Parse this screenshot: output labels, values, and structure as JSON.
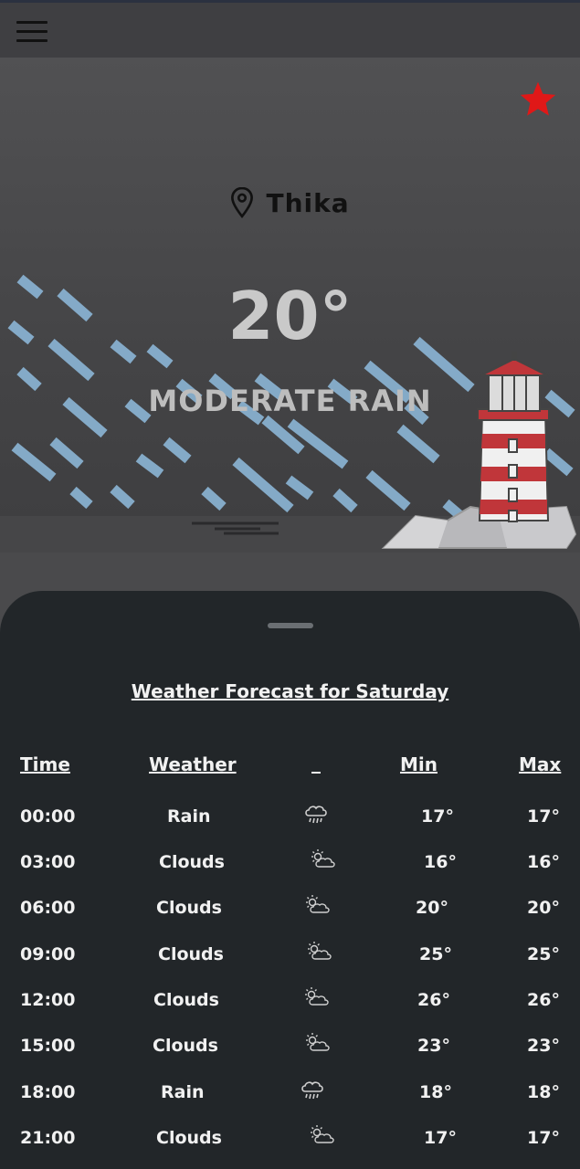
{
  "header": {
    "menu_icon": "hamburger-menu-icon"
  },
  "hero": {
    "favorite_icon": "star-icon",
    "favorite_color": "#e01818",
    "location_icon": "map-pin-icon",
    "city": "Thika",
    "temperature": "20°",
    "description": "MODERATE RAIN",
    "rain_color": "#88b0cf"
  },
  "forecast": {
    "title": "Weather Forecast for Saturday",
    "columns": [
      "Time",
      "Weather",
      "_",
      "Min",
      "Max"
    ],
    "rows": [
      {
        "time": "00:00",
        "weather": "Rain",
        "icon": "rain-cloud-icon",
        "min": "17°",
        "max": "17°"
      },
      {
        "time": "03:00",
        "weather": "Clouds",
        "icon": "sun-cloud-icon",
        "min": "16°",
        "max": "16°"
      },
      {
        "time": "06:00",
        "weather": "Clouds",
        "icon": "sun-cloud-icon",
        "min": "20°",
        "max": "20°"
      },
      {
        "time": "09:00",
        "weather": "Clouds",
        "icon": "sun-cloud-icon",
        "min": "25°",
        "max": "25°"
      },
      {
        "time": "12:00",
        "weather": "Clouds",
        "icon": "sun-cloud-icon",
        "min": "26°",
        "max": "26°"
      },
      {
        "time": "15:00",
        "weather": "Clouds",
        "icon": "sun-cloud-icon",
        "min": "23°",
        "max": "23°"
      },
      {
        "time": "18:00",
        "weather": "Rain",
        "icon": "rain-cloud-icon",
        "min": "18°",
        "max": "18°"
      },
      {
        "time": "21:00",
        "weather": "Clouds",
        "icon": "sun-cloud-icon",
        "min": "17°",
        "max": "17°"
      }
    ]
  }
}
